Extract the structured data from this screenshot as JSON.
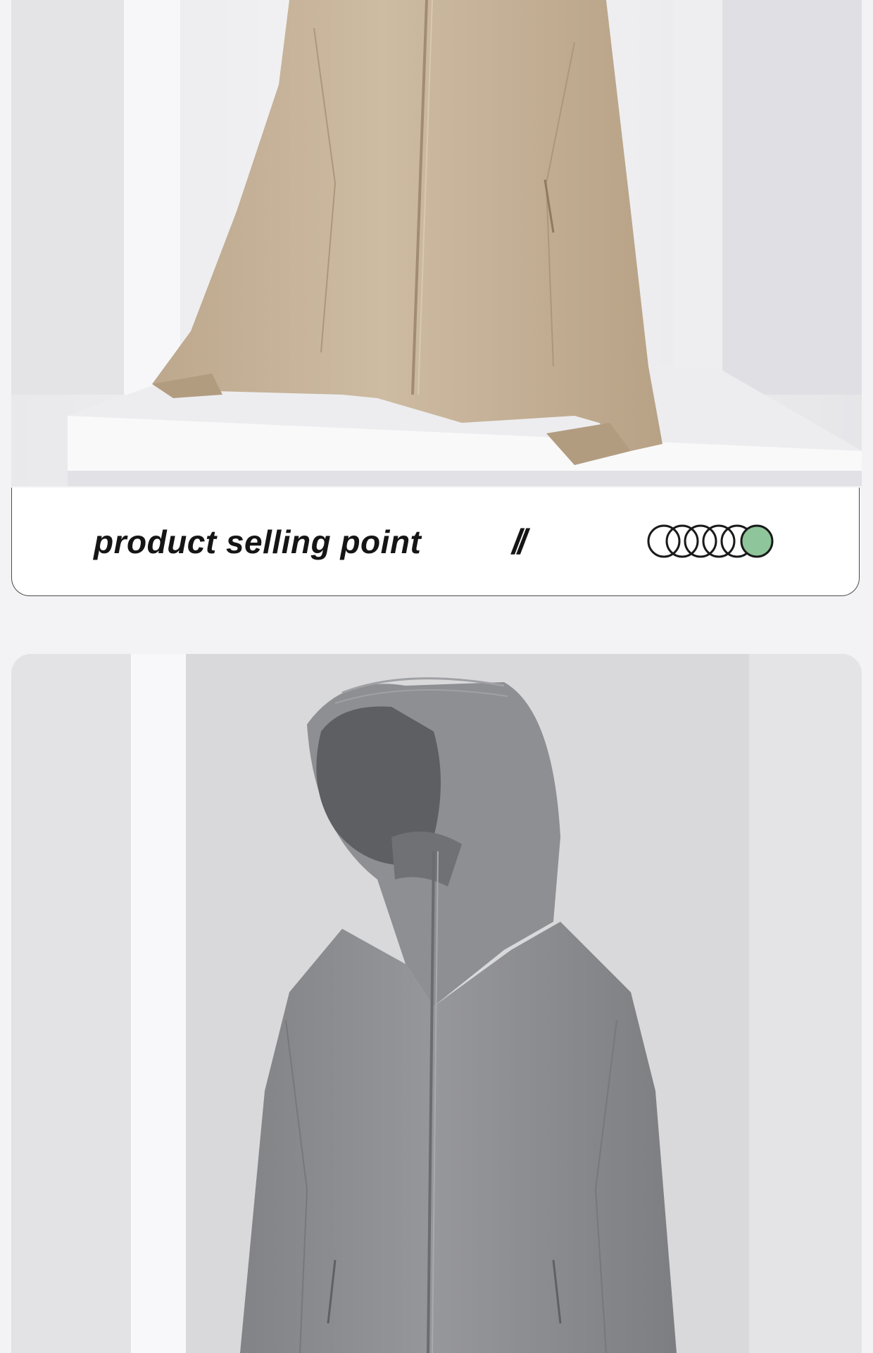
{
  "banner": {
    "title": "product selling point",
    "divider": "//"
  },
  "icons": {
    "divider": "double-slash-icon",
    "rings": "interlocking-rings-icon"
  },
  "photos": {
    "top": "beige-hooded-jacket-photo",
    "bottom": "grey-hooded-jacket-photo"
  },
  "colors": {
    "page_background": "#f3f3f5",
    "jacket_beige": "#c7b49b",
    "jacket_grey": "#8d8e90",
    "ring_accent": "#8ec59a",
    "text": "#151515"
  },
  "rings": {
    "count": 6,
    "highlighted_index": 5
  }
}
